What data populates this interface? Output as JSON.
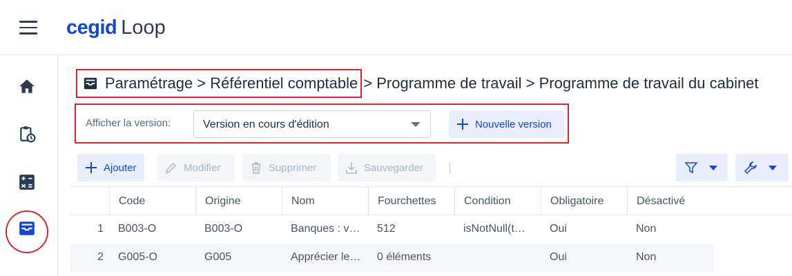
{
  "app": {
    "brand": "cegid",
    "product": "Loop"
  },
  "nav": {
    "items": [
      {
        "icon": "home-icon"
      },
      {
        "icon": "clipboard-clock-icon"
      },
      {
        "icon": "calculator-icon"
      },
      {
        "icon": "inbox-icon",
        "active": true
      }
    ]
  },
  "breadcrumb": {
    "part1": "Paramétrage > Référentiel comptable",
    "part2": "> Programme de travail > Programme de travail du cabinet"
  },
  "version": {
    "label": "Afficher la version:",
    "selected": "Version en cours d'édition",
    "new_button": "Nouvelle version"
  },
  "toolbar": {
    "add": "Ajouter",
    "edit": "Modifier",
    "delete": "Supprimer",
    "save": "Sauvegarder"
  },
  "colors": {
    "accent": "#1246d8",
    "highlight": "#d9252b",
    "button_bg": "#e8eefc"
  },
  "table": {
    "columns": [
      "Code",
      "Origine",
      "Nom",
      "Fourchettes",
      "Condition",
      "Obligatoire",
      "Désactivé"
    ],
    "rows": [
      {
        "num": "1",
        "code": "B003-O",
        "origine": "B003-O",
        "nom": "Banques : v…",
        "fourchettes": "512",
        "condition": "isNotNull(t…",
        "obligatoire": "Oui",
        "desactive": "Non"
      },
      {
        "num": "2",
        "code": "G005-O",
        "origine": "G005",
        "nom": "Apprécier le…",
        "fourchettes": "0 éléments",
        "condition": "",
        "obligatoire": "Oui",
        "desactive": "Non"
      }
    ]
  }
}
